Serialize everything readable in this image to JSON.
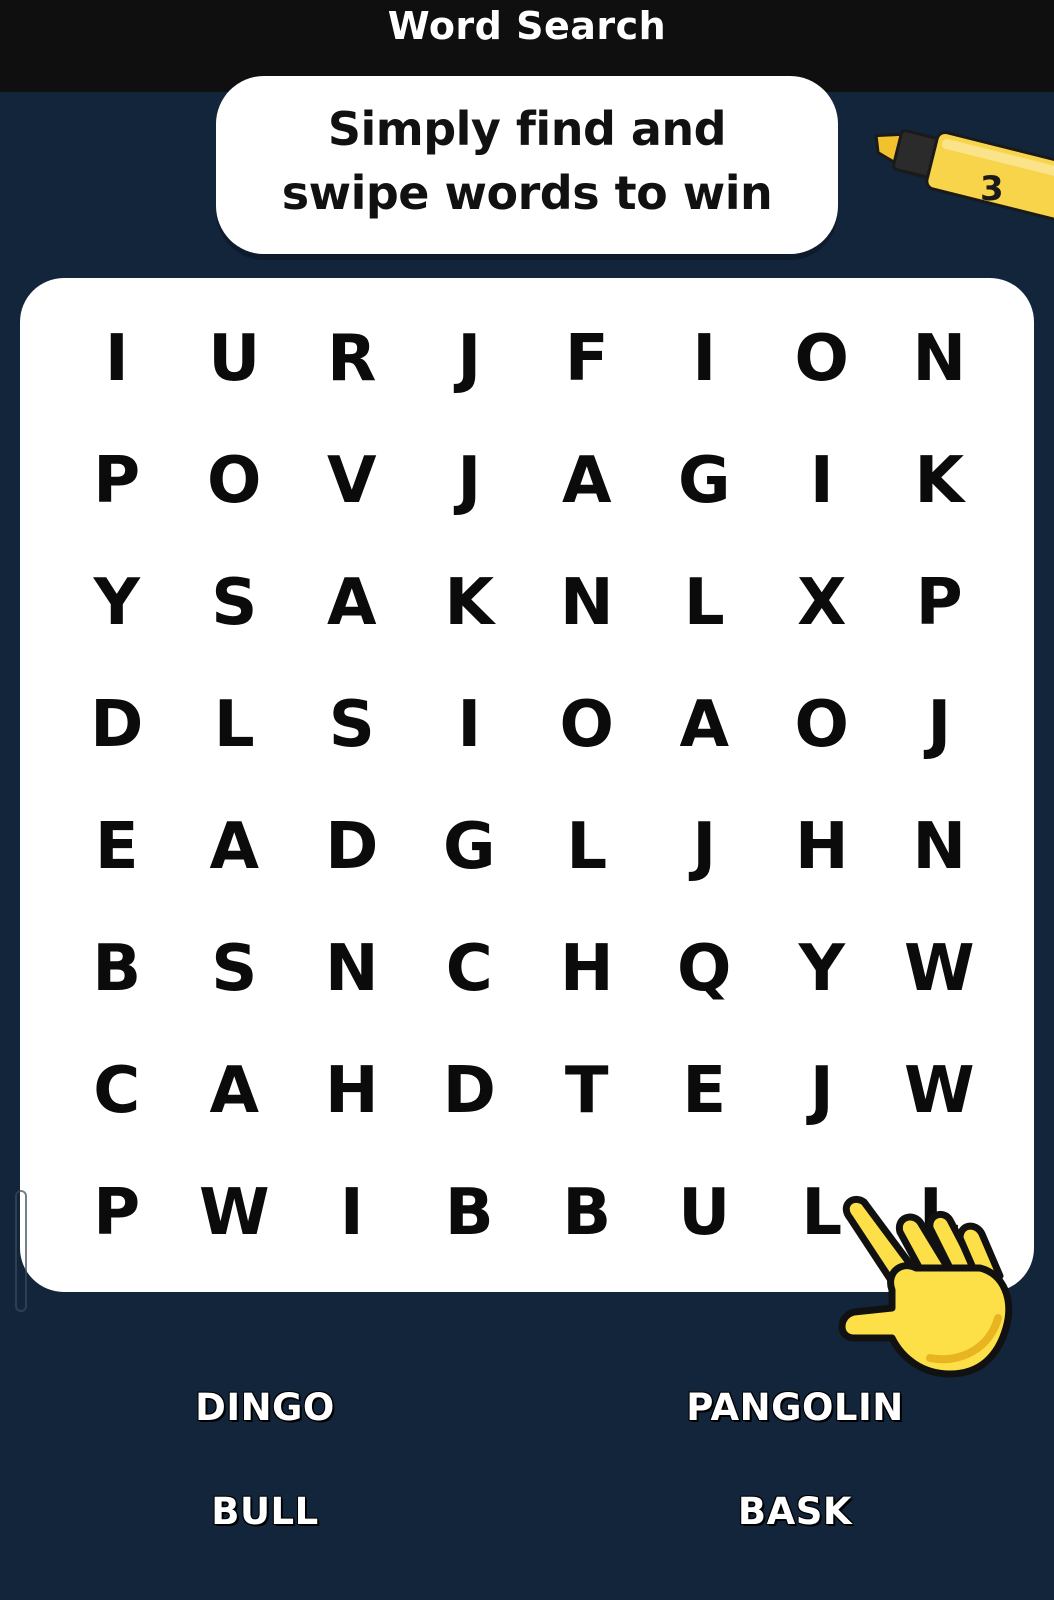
{
  "header": {
    "title": "Word Search"
  },
  "prompt": {
    "line1": "Simply find and",
    "line2": "swipe words to win"
  },
  "highlighter": {
    "count": "3",
    "icon": "highlighter-icon",
    "color": "#f7d44a"
  },
  "grid": {
    "rows": [
      [
        "I",
        "U",
        "R",
        "J",
        "F",
        "I",
        "O",
        "N"
      ],
      [
        "P",
        "O",
        "V",
        "J",
        "A",
        "G",
        "I",
        "K"
      ],
      [
        "Y",
        "S",
        "A",
        "K",
        "N",
        "L",
        "X",
        "P"
      ],
      [
        "D",
        "L",
        "S",
        "I",
        "O",
        "A",
        "O",
        "J"
      ],
      [
        "E",
        "A",
        "D",
        "G",
        "L",
        "J",
        "H",
        "N"
      ],
      [
        "B",
        "S",
        "N",
        "C",
        "H",
        "Q",
        "Y",
        "W"
      ],
      [
        "C",
        "A",
        "H",
        "D",
        "T",
        "E",
        "J",
        "W"
      ],
      [
        "P",
        "W",
        "I",
        "B",
        "B",
        "U",
        "L",
        "L"
      ]
    ]
  },
  "pointer": {
    "icon": "pointing-hand-icon",
    "color": "#fde047"
  },
  "words": [
    {
      "label": "DINGO"
    },
    {
      "label": "PANGOLIN"
    },
    {
      "label": "BULL"
    },
    {
      "label": "BASK"
    }
  ],
  "colors": {
    "background": "#12253b",
    "topbar": "#0f0f0f",
    "board": "#ffffff"
  }
}
